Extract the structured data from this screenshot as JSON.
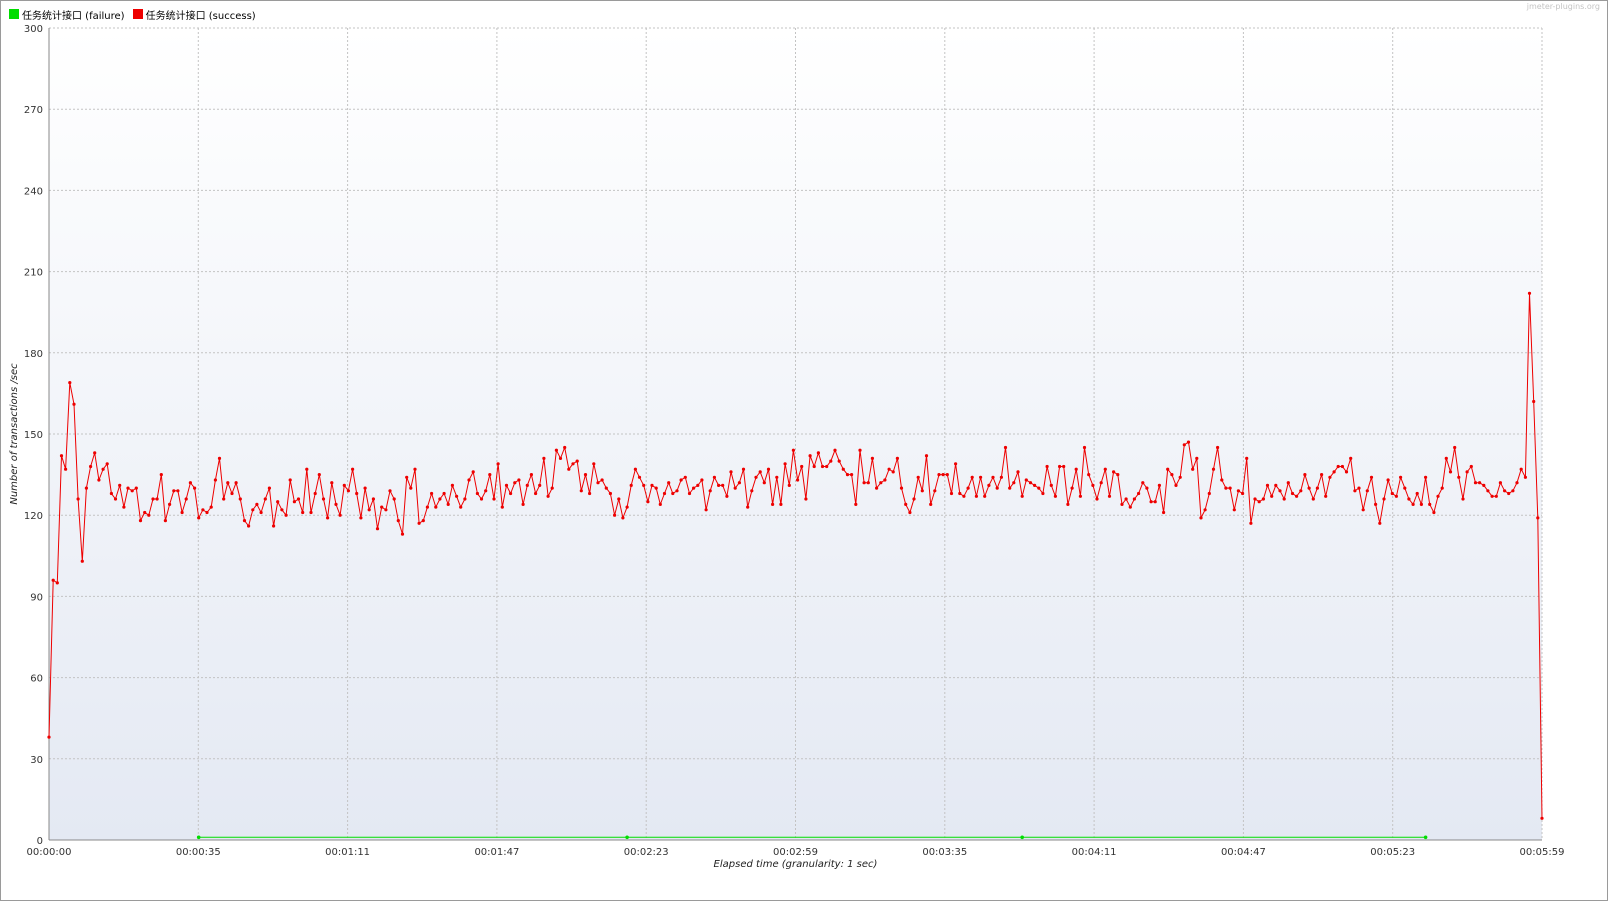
{
  "watermark": "jmeter-plugins.org",
  "legend": [
    {
      "label": "任务统计接口 (failure)",
      "color": "#00dd00"
    },
    {
      "label": "任务统计接口 (success)",
      "color": "#ee0000"
    }
  ],
  "chart_data": {
    "type": "line",
    "xlabel": "Elapsed time (granularity: 1 sec)",
    "ylabel": "Number of transactions /sec",
    "ylim": [
      0,
      300
    ],
    "xlim": [
      0,
      359
    ],
    "y_ticks": [
      0,
      30,
      60,
      90,
      120,
      150,
      180,
      210,
      240,
      270,
      300
    ],
    "x_tick_labels": [
      "00:00:00",
      "00:00:35",
      "00:01:11",
      "00:01:47",
      "00:02:23",
      "00:02:59",
      "00:03:35",
      "00:04:11",
      "00:04:47",
      "00:05:23",
      "00:05:59"
    ],
    "grid": true,
    "series": [
      {
        "name": "任务统计接口 (failure)",
        "color": "#00dd00",
        "points": [
          [
            36,
            1
          ],
          [
            139,
            1
          ],
          [
            234,
            1
          ],
          [
            331,
            1
          ]
        ]
      },
      {
        "name": "任务统计接口 (success)",
        "color": "#ee0000",
        "values": [
          38,
          96,
          95,
          142,
          137,
          169,
          161,
          126,
          103,
          130,
          138,
          143,
          133,
          137,
          139,
          128,
          126,
          131,
          123,
          130,
          129,
          130,
          118,
          121,
          120,
          126,
          126,
          135,
          118,
          124,
          129,
          129,
          121,
          126,
          132,
          130,
          119,
          122,
          121,
          123,
          133,
          141,
          126,
          132,
          128,
          132,
          126,
          118,
          116,
          122,
          124,
          121,
          126,
          130,
          116,
          125,
          122,
          120,
          133,
          125,
          126,
          121,
          137,
          121,
          128,
          135,
          126,
          119,
          132,
          124,
          120,
          131,
          129,
          137,
          128,
          119,
          130,
          122,
          126,
          115,
          123,
          122,
          129,
          126,
          118,
          113,
          134,
          130,
          137,
          117,
          118,
          123,
          128,
          123,
          126,
          128,
          124,
          131,
          127,
          123,
          126,
          133,
          136,
          128,
          126,
          129,
          135,
          126,
          139,
          123,
          131,
          128,
          132,
          133,
          124,
          131,
          135,
          128,
          131,
          141,
          127,
          130,
          144,
          141,
          145,
          137,
          139,
          140,
          129,
          135,
          128,
          139,
          132,
          133,
          130,
          128,
          120,
          126,
          119,
          123,
          131,
          137,
          134,
          131,
          125,
          131,
          130,
          124,
          128,
          132,
          128,
          129,
          133,
          134,
          128,
          130,
          131,
          133,
          122,
          129,
          134,
          131,
          131,
          127,
          136,
          130,
          132,
          137,
          123,
          129,
          134,
          136,
          132,
          137,
          124,
          134,
          124,
          139,
          131,
          144,
          133,
          138,
          126,
          142,
          138,
          143,
          138,
          138,
          140,
          144,
          140,
          137,
          135,
          135,
          124,
          144,
          132,
          132,
          141,
          130,
          132,
          133,
          137,
          136,
          141,
          130,
          124,
          121,
          126,
          134,
          129,
          142,
          124,
          129,
          135,
          135,
          135,
          128,
          139,
          128,
          127,
          130,
          134,
          127,
          134,
          127,
          131,
          134,
          130,
          134,
          145,
          130,
          132,
          136,
          127,
          133,
          132,
          131,
          130,
          128,
          138,
          131,
          127,
          138,
          138,
          124,
          130,
          137,
          127,
          145,
          135,
          131,
          126,
          132,
          137,
          127,
          136,
          135,
          124,
          126,
          123,
          126,
          128,
          132,
          130,
          125,
          125,
          131,
          121,
          137,
          135,
          131,
          134,
          146,
          147,
          137,
          141,
          119,
          122,
          128,
          137,
          145,
          133,
          130,
          130,
          122,
          129,
          128,
          141,
          117,
          126,
          125,
          126,
          131,
          127,
          131,
          129,
          126,
          132,
          128,
          127,
          129,
          135,
          130,
          126,
          130,
          135,
          127,
          134,
          136,
          138,
          138,
          136,
          141,
          129,
          130,
          122,
          129,
          134,
          124,
          117,
          126,
          133,
          128,
          127,
          134,
          130,
          126,
          124,
          128,
          124,
          134,
          124,
          121,
          127,
          130,
          141,
          136,
          145,
          134,
          126,
          136,
          138,
          132,
          132,
          131,
          129,
          127,
          127,
          132,
          129,
          128,
          129,
          132,
          137,
          134,
          202,
          162,
          119,
          8
        ]
      }
    ]
  }
}
